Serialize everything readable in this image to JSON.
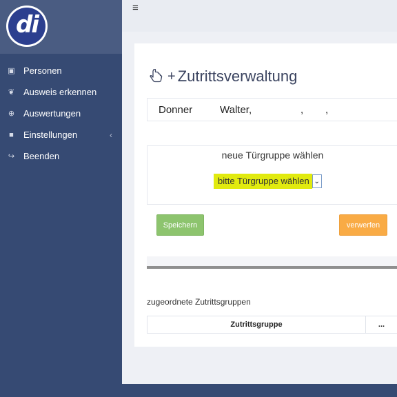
{
  "app": {
    "logo_text": "di"
  },
  "sidebar": {
    "items": [
      {
        "label": "Personen",
        "icon": "person-card-icon",
        "glyph": "▣"
      },
      {
        "label": "Ausweis erkennen",
        "icon": "binoculars-icon",
        "glyph": "❦"
      },
      {
        "label": "Auswertungen",
        "icon": "plus-circle-icon",
        "glyph": "⊕"
      },
      {
        "label": "Einstellungen",
        "icon": "lock-icon",
        "glyph": "■",
        "chevron": "‹"
      },
      {
        "label": "Beenden",
        "icon": "sign-out-icon",
        "glyph": "↪"
      }
    ]
  },
  "topbar": {
    "menu_glyph": "≡"
  },
  "page": {
    "title": "Zutrittsverwaltung",
    "title_icon": "hand-pointer-plus-icon"
  },
  "person": {
    "lastname": "Donner",
    "firstname": "Walter,",
    "sep1": ",",
    "sep2": ","
  },
  "door_group": {
    "label": "neue Türgruppe wählen",
    "select_value": "bitte Türgruppe wählen",
    "select_arrow": "⌄"
  },
  "buttons": {
    "save": "Speichern",
    "discard": "verwerfen"
  },
  "assigned": {
    "label": "zugeordnete Zutrittsgruppen",
    "columns": [
      "Zutrittsgruppe",
      "..."
    ]
  },
  "colors": {
    "sidebar": "#364a73",
    "save_button": "#8dc46e",
    "discard_button": "#f9ab45",
    "select_highlight": "#e1ea0f"
  }
}
